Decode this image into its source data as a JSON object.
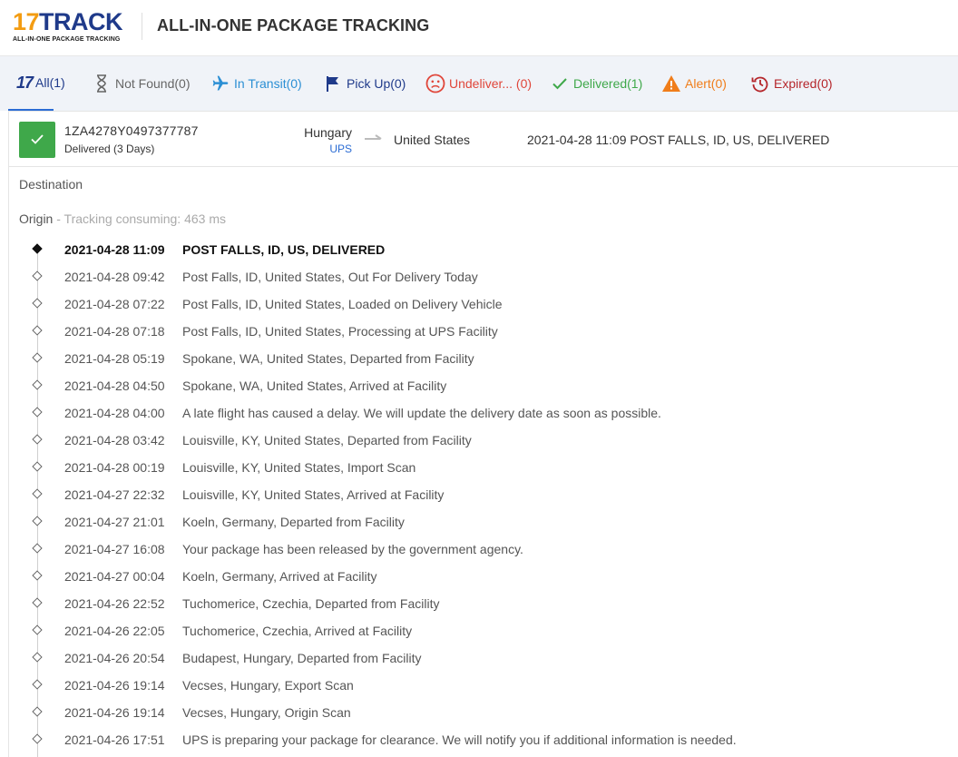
{
  "header": {
    "logo_number": "17",
    "logo_word": "TRACK",
    "logo_tagline": "ALL-IN-ONE PACKAGE TRACKING",
    "title": "ALL-IN-ONE PACKAGE TRACKING"
  },
  "tabs": [
    {
      "label": "All(1)",
      "icon": "17-logo-icon",
      "color": "#1f3a8a",
      "active": true
    },
    {
      "label": "Not Found(0)",
      "icon": "hourglass-icon",
      "color": "#666666"
    },
    {
      "label": "In Transit(0)",
      "icon": "airplane-icon",
      "color": "#2b8fd4"
    },
    {
      "label": "Pick Up(0)",
      "icon": "flag-icon",
      "color": "#1f3a8a"
    },
    {
      "label": "Undeliver... (0)",
      "icon": "sad-face-icon",
      "color": "#e0463a"
    },
    {
      "label": "Delivered(1)",
      "icon": "checkmark-icon",
      "color": "#3fa84a"
    },
    {
      "label": "Alert(0)",
      "icon": "warning-icon",
      "color": "#f07d1a"
    },
    {
      "label": "Expired(0)",
      "icon": "history-icon",
      "color": "#b5262b"
    }
  ],
  "package": {
    "tracking_number": "1ZA4278Y0497377787",
    "status_text": "Delivered (3 Days)",
    "origin_country": "Hungary",
    "carrier": "UPS",
    "destination_country": "United States",
    "last_event": "2021-04-28 11:09  POST FALLS, ID, US, DELIVERED",
    "status_color": "#3fa84a"
  },
  "details": {
    "destination_label": "Destination",
    "origin_label": "Origin",
    "tracking_consuming": " - Tracking consuming: 463 ms"
  },
  "events": [
    {
      "time": "2021-04-28 11:09",
      "desc": "POST FALLS, ID, US, DELIVERED"
    },
    {
      "time": "2021-04-28 09:42",
      "desc": "Post Falls, ID, United States, Out For Delivery Today"
    },
    {
      "time": "2021-04-28 07:22",
      "desc": "Post Falls, ID, United States, Loaded on Delivery Vehicle"
    },
    {
      "time": "2021-04-28 07:18",
      "desc": "Post Falls, ID, United States, Processing at UPS Facility"
    },
    {
      "time": "2021-04-28 05:19",
      "desc": "Spokane, WA, United States, Departed from Facility"
    },
    {
      "time": "2021-04-28 04:50",
      "desc": "Spokane, WA, United States, Arrived at Facility"
    },
    {
      "time": "2021-04-28 04:00",
      "desc": "A late flight has caused a delay. We will update the delivery date as soon as possible."
    },
    {
      "time": "2021-04-28 03:42",
      "desc": "Louisville, KY, United States, Departed from Facility"
    },
    {
      "time": "2021-04-28 00:19",
      "desc": "Louisville, KY, United States, Import Scan"
    },
    {
      "time": "2021-04-27 22:32",
      "desc": "Louisville, KY, United States, Arrived at Facility"
    },
    {
      "time": "2021-04-27 21:01",
      "desc": "Koeln, Germany, Departed from Facility"
    },
    {
      "time": "2021-04-27 16:08",
      "desc": "Your package has been released by the government agency."
    },
    {
      "time": "2021-04-27 00:04",
      "desc": "Koeln, Germany, Arrived at Facility"
    },
    {
      "time": "2021-04-26 22:52",
      "desc": "Tuchomerice, Czechia, Departed from Facility"
    },
    {
      "time": "2021-04-26 22:05",
      "desc": "Tuchomerice, Czechia, Arrived at Facility"
    },
    {
      "time": "2021-04-26 20:54",
      "desc": "Budapest, Hungary, Departed from Facility"
    },
    {
      "time": "2021-04-26 19:14",
      "desc": "Vecses, Hungary, Export Scan"
    },
    {
      "time": "2021-04-26 19:14",
      "desc": "Vecses, Hungary, Origin Scan"
    },
    {
      "time": "2021-04-26 17:51",
      "desc": "UPS is preparing your package for clearance. We will notify you if additional information is needed."
    }
  ]
}
